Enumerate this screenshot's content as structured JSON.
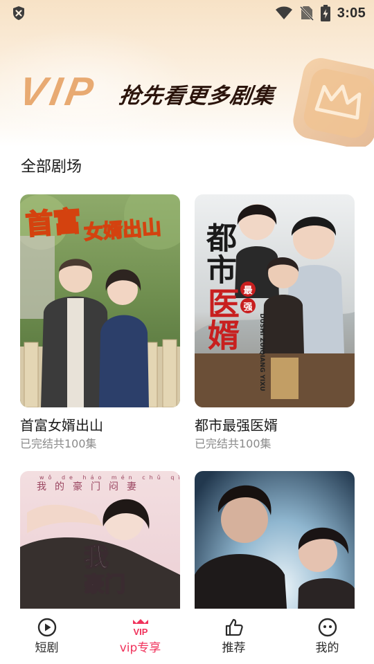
{
  "status_bar": {
    "time": "3:05"
  },
  "banner": {
    "vip_text": "VIP",
    "slogan": "抢先看更多剧集"
  },
  "section": {
    "title": "全部剧场"
  },
  "dramas": [
    {
      "title": "首富女婿出山",
      "meta": "已完结共100集",
      "poster_title": "首富",
      "poster_title_small": "女婿出山"
    },
    {
      "title": "都市最强医婿",
      "meta": "已完结共100集",
      "poster_title_top": "都市",
      "poster_title_badge1": "最",
      "poster_title_badge2": "强",
      "poster_title_bottom": "医婿",
      "poster_pinyin": "DUSHI ZUIQIANG YIXU"
    },
    {
      "title": "",
      "meta": "",
      "poster_pinyin": "wǒ de háo mén chǔ qī",
      "poster_chars": "我的豪门闷妻",
      "poster_title": "我",
      "poster_title2": "豪门"
    },
    {
      "title": "",
      "meta": ""
    }
  ],
  "tabs": [
    {
      "label": "短剧",
      "icon": "play-circle-icon",
      "active": false
    },
    {
      "label": "vip专享",
      "icon": "vip-crown-icon",
      "active": true,
      "icon_text": "VIP"
    },
    {
      "label": "推荐",
      "icon": "thumbs-up-icon",
      "active": false
    },
    {
      "label": "我的",
      "icon": "smiley-face-icon",
      "active": false
    }
  ],
  "colors": {
    "accent": "#f0335c",
    "vip_gold": "#e8aa72",
    "slogan": "#2b140c",
    "banner_bg": "#f7e2c6"
  }
}
